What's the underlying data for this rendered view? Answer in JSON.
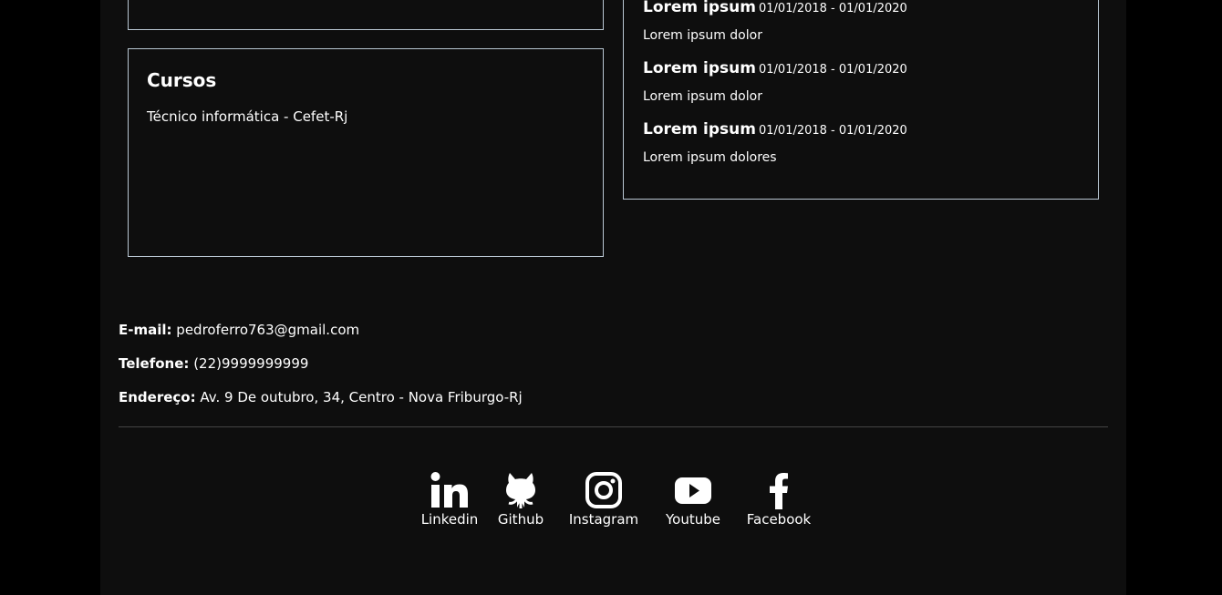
{
  "cursos": {
    "title": "Cursos",
    "items": [
      "Técnico informática - Cefet-Rj"
    ]
  },
  "experiencia": {
    "items": [
      {
        "title": "Lorem ipsum",
        "dates": "01/01/2018 - 01/01/2020",
        "desc": "Lorem ipsum dolor"
      },
      {
        "title": "Lorem ipsum",
        "dates": "01/01/2018 - 01/01/2020",
        "desc": "Lorem ipsum dolor"
      },
      {
        "title": "Lorem ipsum",
        "dates": "01/01/2018 - 01/01/2020",
        "desc": "Lorem ipsum dolores"
      }
    ]
  },
  "contato": {
    "email_label": "E-mail:",
    "email": "pedroferro763@gmail.com",
    "telefone_label": "Telefone:",
    "telefone": "(22)9999999999",
    "endereco_label": "Endereço:",
    "endereco": "Av. 9 De outubro, 34, Centro - Nova Friburgo-Rj"
  },
  "social": [
    {
      "label": "Linkedin",
      "icon": "linkedin-icon"
    },
    {
      "label": "Github",
      "icon": "github-icon"
    },
    {
      "label": "Instagram",
      "icon": "instagram-icon"
    },
    {
      "label": "Youtube",
      "icon": "youtube-icon"
    },
    {
      "label": "Facebook",
      "icon": "facebook-icon"
    }
  ],
  "colors": {
    "background": "#000000",
    "page": "#0e0e0e",
    "border": "#b9c7d3",
    "text": "#ffffff",
    "divider": "#444444"
  }
}
